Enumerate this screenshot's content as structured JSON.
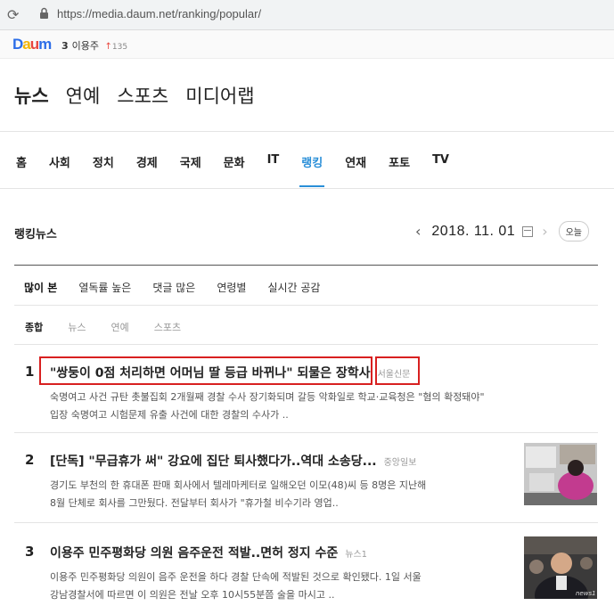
{
  "browser": {
    "url": "https://media.daum.net/ranking/popular/"
  },
  "topbar": {
    "logo_letters": [
      "D",
      "a",
      "u",
      "m"
    ],
    "trend_rank": "3",
    "trend_keyword": "이용주",
    "trend_arrow": "↑",
    "trend_count": "135"
  },
  "sections": [
    "뉴스",
    "연예",
    "스포츠",
    "미디어랩"
  ],
  "categories": [
    "홈",
    "사회",
    "정치",
    "경제",
    "국제",
    "문화",
    "IT",
    "랭킹",
    "연재",
    "포토",
    "TV"
  ],
  "ranking": {
    "title": "랭킹뉴스",
    "date": "2018. 11. 01",
    "today_label": "오늘"
  },
  "sort_tabs": [
    "많이 본",
    "열독률 높은",
    "댓글 많은",
    "연령별",
    "실시간 공감"
  ],
  "sub_tabs": [
    "종합",
    "뉴스",
    "연예",
    "스포츠"
  ],
  "news": [
    {
      "rank": "1",
      "title": "\"쌍둥이 0점 처리하면 어머님 딸 등급 바뀌나\" 되물은 장학사",
      "source": "서울신문",
      "desc1": "숙명여고 사건 규탄 촛불집회 2개월째 경찰 수사 장기화되며 갈등 악화일로 학교·교육청은 \"혐의 확정돼야\"",
      "desc2": "입장 숙명여고 시험문제 유출 사건에 대한 경찰의 수사가 .."
    },
    {
      "rank": "2",
      "title": "[단독] \"무급휴가 써\" 강요에 집단 퇴사했다가..역대 소송당...",
      "source": "중앙일보",
      "desc1": "경기도 부천의 한 휴대폰 판매 회사에서 텔레마케터로 일해오던 이모(48)씨 등 8명은 지난해",
      "desc2": "8월 단체로 회사를 그만뒀다. 전달부터 회사가 \"휴가철 비수기라 영업..",
      "thumb": "office-worker-photo"
    },
    {
      "rank": "3",
      "title": "이용주 민주평화당 의원 음주운전 적발..면허 정지 수준",
      "source": "뉴스1",
      "desc1": "이용주 민주평화당 의원이 음주 운전을 하다 경찰 단속에 적발된 것으로 확인됐다. 1일 서울",
      "desc2": "강남경찰서에 따르면 이 의원은 전날 오후 10시55분쯤 술을 마시고 ..",
      "thumb": "politician-photo",
      "thumb_caption": "news1"
    }
  ]
}
